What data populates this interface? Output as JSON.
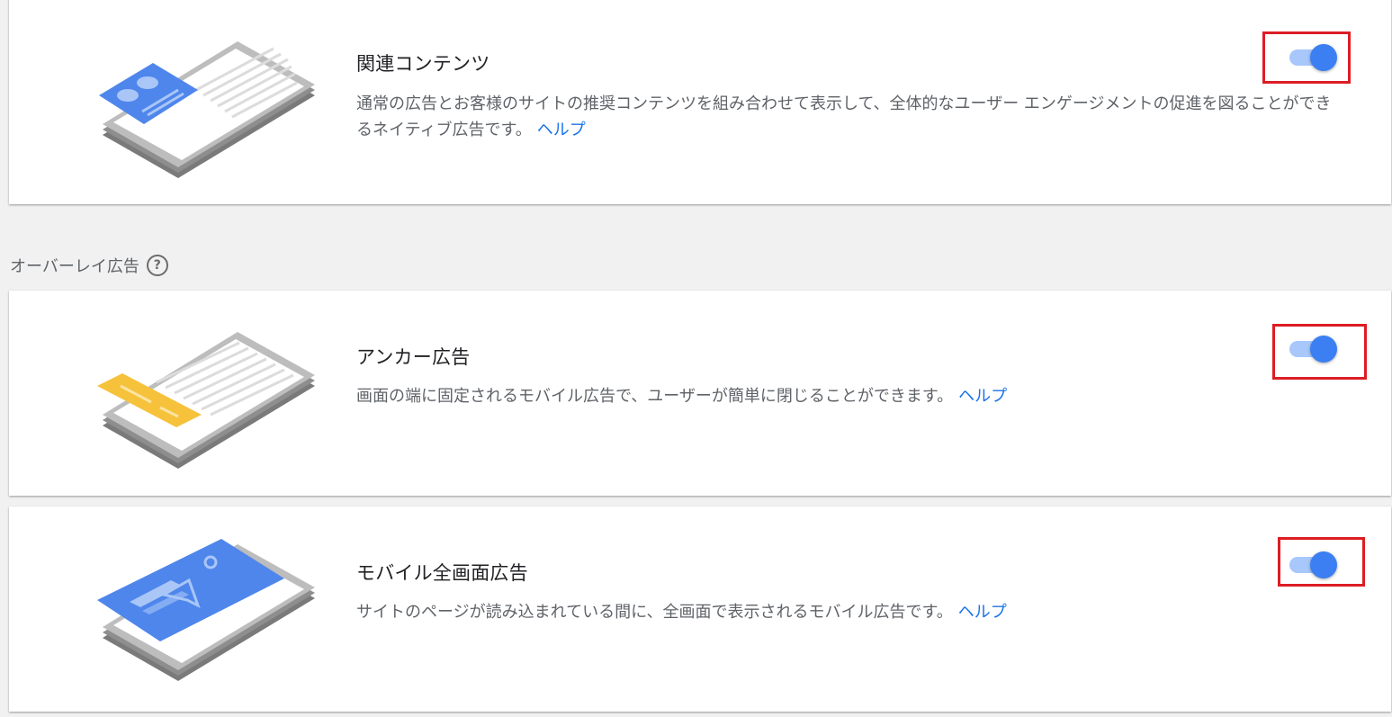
{
  "cards": [
    {
      "title": "関連コンテンツ",
      "description": "通常の広告とお客様のサイトの推奨コンテンツを組み合わせて表示して、全体的なユーザー エンゲージメントの促進を図ることができるネイティブ広告です。",
      "help_label": "ヘルプ",
      "toggle_on": true,
      "icon": "related-content-illustration"
    },
    {
      "title": "アンカー広告",
      "description": "画面の端に固定されるモバイル広告で、ユーザーが簡単に閉じることができます。",
      "help_label": "ヘルプ",
      "toggle_on": true,
      "icon": "anchor-ad-illustration"
    },
    {
      "title": "モバイル全画面広告",
      "description": "サイトのページが読み込まれている間に、全画面で表示されるモバイル広告です。",
      "help_label": "ヘルプ",
      "toggle_on": true,
      "icon": "vignette-ad-illustration"
    }
  ],
  "section": {
    "label": "オーバーレイ広告",
    "help_icon": "?"
  },
  "colors": {
    "accent": "#3c7ff2",
    "track": "#a8c7fa",
    "highlight": "#dd1d24",
    "link": "#1a73e8",
    "ad_yellow": "#f6c23b"
  }
}
